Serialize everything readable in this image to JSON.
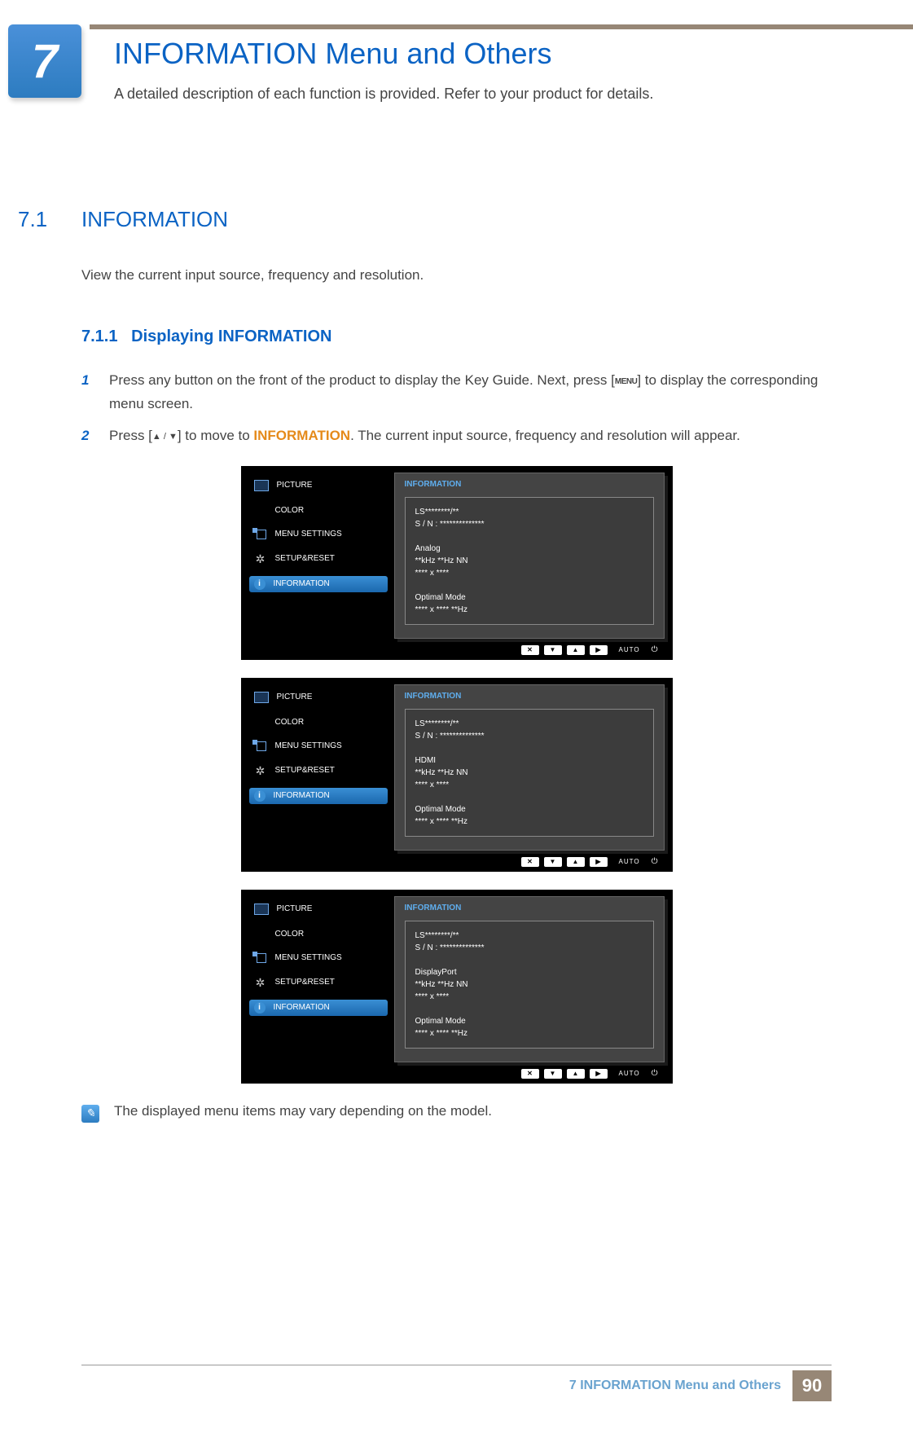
{
  "chapter": {
    "number": "7",
    "title": "INFORMATION Menu and Others",
    "subtitle": "A detailed description of each function is provided. Refer to your product for details."
  },
  "section": {
    "number": "7.1",
    "title": "INFORMATION",
    "body": "View the current input source, frequency and resolution."
  },
  "subsection": {
    "number": "7.1.1",
    "title": "Displaying INFORMATION"
  },
  "steps": {
    "s1_pre": "Press any button on the front of the product to display the Key Guide. Next, press [",
    "s1_menu": "MENU",
    "s1_post": "] to display the corresponding menu screen.",
    "s2_pre": "Press [",
    "s2_arrows": "▲ / ▼",
    "s2_mid": "] to move to ",
    "s2_info": "INFORMATION",
    "s2_post": ". The current input source, frequency and resolution will appear."
  },
  "osd_sidebar": {
    "picture": "PICTURE",
    "color": "COLOR",
    "menu_settings": "MENU SETTINGS",
    "setup_reset": "SETUP&RESET",
    "information": "INFORMATION"
  },
  "osd_panel_title": "INFORMATION",
  "osd_panels": [
    "LS********/**\nS / N : **************\n\nAnalog\n**kHz **Hz NN\n**** x ****\n\nOptimal Mode\n**** x **** **Hz",
    "LS********/**\nS / N : **************\n\nHDMI\n**kHz **Hz NN\n**** x ****\n\nOptimal Mode\n**** x **** **Hz",
    "LS********/**\nS / N : **************\n\nDisplayPort\n**kHz **Hz NN\n**** x ****\n\nOptimal Mode\n**** x **** **Hz"
  ],
  "osd_nav": {
    "close": "✕",
    "down": "▼",
    "up": "▲",
    "right": "▶",
    "auto": "AUTO",
    "power": "⏻"
  },
  "note": "The displayed menu items may vary depending on the model.",
  "footer": {
    "text": "7 INFORMATION Menu and Others",
    "page": "90"
  }
}
